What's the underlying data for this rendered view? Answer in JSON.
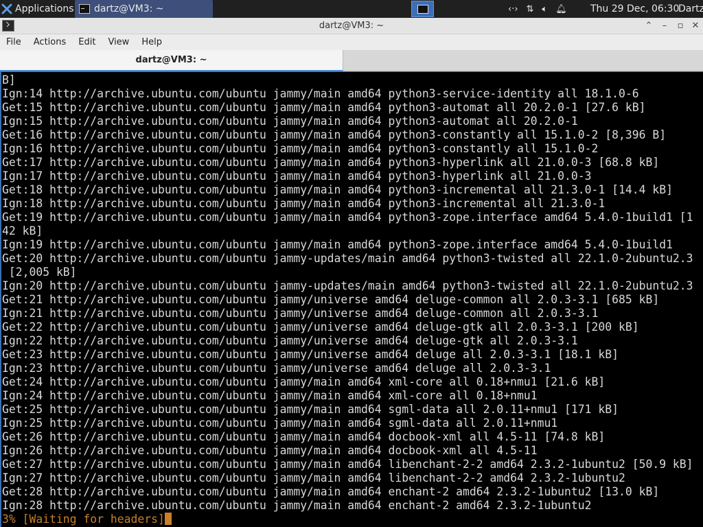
{
  "panel": {
    "app_menu_label": "Applications",
    "task_label": "dartz@VM3: ~",
    "clock": "Thu 29 Dec, 06:30",
    "user": "Dartz"
  },
  "window": {
    "title": "dartz@VM3: ~",
    "menu": [
      "File",
      "Actions",
      "Edit",
      "View",
      "Help"
    ],
    "tab_label": "dartz@VM3: ~"
  },
  "terminal": {
    "lines": [
      "B]",
      "Ign:14 http://archive.ubuntu.com/ubuntu jammy/main amd64 python3-service-identity all 18.1.0-6",
      "Get:15 http://archive.ubuntu.com/ubuntu jammy/main amd64 python3-automat all 20.2.0-1 [27.6 kB]",
      "Ign:15 http://archive.ubuntu.com/ubuntu jammy/main amd64 python3-automat all 20.2.0-1",
      "Get:16 http://archive.ubuntu.com/ubuntu jammy/main amd64 python3-constantly all 15.1.0-2 [8,396 B]",
      "Ign:16 http://archive.ubuntu.com/ubuntu jammy/main amd64 python3-constantly all 15.1.0-2",
      "Get:17 http://archive.ubuntu.com/ubuntu jammy/main amd64 python3-hyperlink all 21.0.0-3 [68.8 kB]",
      "Ign:17 http://archive.ubuntu.com/ubuntu jammy/main amd64 python3-hyperlink all 21.0.0-3",
      "Get:18 http://archive.ubuntu.com/ubuntu jammy/main amd64 python3-incremental all 21.3.0-1 [14.4 kB]",
      "Ign:18 http://archive.ubuntu.com/ubuntu jammy/main amd64 python3-incremental all 21.3.0-1",
      "Get:19 http://archive.ubuntu.com/ubuntu jammy/main amd64 python3-zope.interface amd64 5.4.0-1build1 [1",
      "42 kB]",
      "Ign:19 http://archive.ubuntu.com/ubuntu jammy/main amd64 python3-zope.interface amd64 5.4.0-1build1",
      "Get:20 http://archive.ubuntu.com/ubuntu jammy-updates/main amd64 python3-twisted all 22.1.0-2ubuntu2.3",
      " [2,005 kB]",
      "Ign:20 http://archive.ubuntu.com/ubuntu jammy-updates/main amd64 python3-twisted all 22.1.0-2ubuntu2.3",
      "Get:21 http://archive.ubuntu.com/ubuntu jammy/universe amd64 deluge-common all 2.0.3-3.1 [685 kB]",
      "Ign:21 http://archive.ubuntu.com/ubuntu jammy/universe amd64 deluge-common all 2.0.3-3.1",
      "Get:22 http://archive.ubuntu.com/ubuntu jammy/universe amd64 deluge-gtk all 2.0.3-3.1 [200 kB]",
      "Ign:22 http://archive.ubuntu.com/ubuntu jammy/universe amd64 deluge-gtk all 2.0.3-3.1",
      "Get:23 http://archive.ubuntu.com/ubuntu jammy/universe amd64 deluge all 2.0.3-3.1 [18.1 kB]",
      "Ign:23 http://archive.ubuntu.com/ubuntu jammy/universe amd64 deluge all 2.0.3-3.1",
      "Get:24 http://archive.ubuntu.com/ubuntu jammy/main amd64 xml-core all 0.18+nmu1 [21.6 kB]",
      "Ign:24 http://archive.ubuntu.com/ubuntu jammy/main amd64 xml-core all 0.18+nmu1",
      "Get:25 http://archive.ubuntu.com/ubuntu jammy/main amd64 sgml-data all 2.0.11+nmu1 [171 kB]",
      "Ign:25 http://archive.ubuntu.com/ubuntu jammy/main amd64 sgml-data all 2.0.11+nmu1",
      "Get:26 http://archive.ubuntu.com/ubuntu jammy/main amd64 docbook-xml all 4.5-11 [74.8 kB]",
      "Ign:26 http://archive.ubuntu.com/ubuntu jammy/main amd64 docbook-xml all 4.5-11",
      "Get:27 http://archive.ubuntu.com/ubuntu jammy/main amd64 libenchant-2-2 amd64 2.3.2-1ubuntu2 [50.9 kB]",
      "Ign:27 http://archive.ubuntu.com/ubuntu jammy/main amd64 libenchant-2-2 amd64 2.3.2-1ubuntu2",
      "Get:28 http://archive.ubuntu.com/ubuntu jammy/main amd64 enchant-2 amd64 2.3.2-1ubuntu2 [13.0 kB]",
      "Ign:28 http://archive.ubuntu.com/ubuntu jammy/main amd64 enchant-2 amd64 2.3.2-1ubuntu2"
    ],
    "status_line": "3% [Waiting for headers]",
    "colors": {
      "status": "#c87f2a",
      "text": "#d9d9d9",
      "accent": "#3b6db5"
    }
  }
}
